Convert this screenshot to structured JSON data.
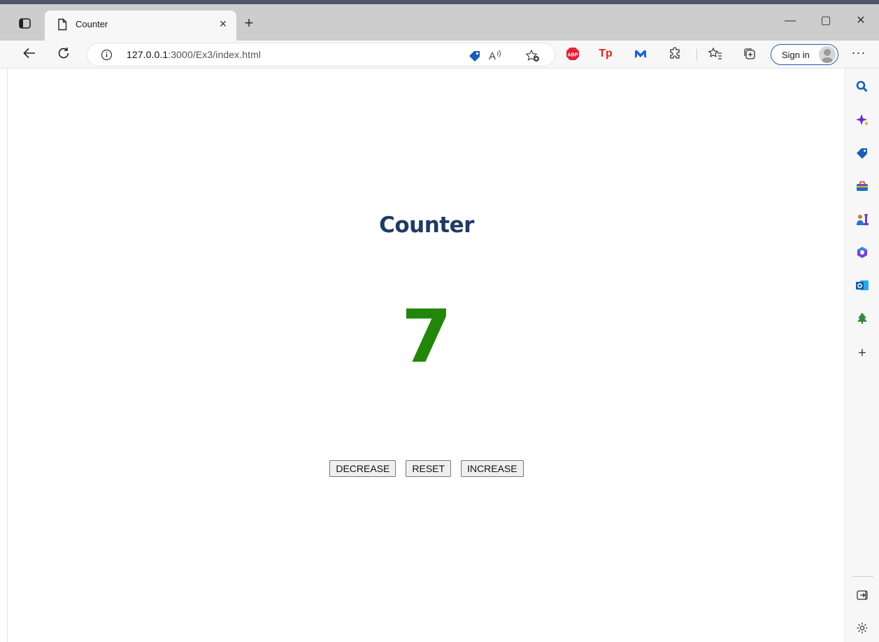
{
  "browser": {
    "tab_title": "Counter",
    "tab_close": "×",
    "new_tab": "+",
    "url_host": "127.0.0.1",
    "url_rest": ":3000/Ex3/index.html",
    "sign_in": "Sign in",
    "more": "···",
    "window_controls": {
      "minimize": "—",
      "maximize": "▢",
      "close": "✕"
    },
    "extensions": [
      {
        "name": "abp",
        "label": "ABP",
        "color": "#e0223a"
      },
      {
        "name": "tp",
        "label": "Tp",
        "color": "#e1251b"
      },
      {
        "name": "malwarebytes",
        "label": "M",
        "color": "#1b61d6"
      }
    ],
    "accent_color": "#1a5fb4"
  },
  "page": {
    "heading": "Counter",
    "count": "7",
    "count_color": "#22860a",
    "buttons": {
      "decrease": "DECREASE",
      "reset": "RESET",
      "increase": "INCREASE"
    }
  },
  "sidebar": {
    "items": [
      "search",
      "copilot",
      "shopping",
      "tools",
      "games",
      "microsoft-365",
      "outlook",
      "e-tree",
      "add"
    ],
    "add_label": "+"
  }
}
